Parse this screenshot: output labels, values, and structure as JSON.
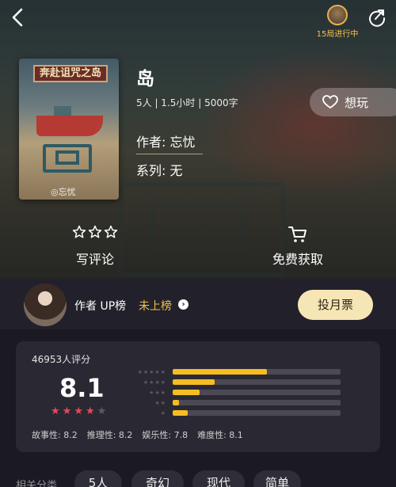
{
  "header": {
    "progress_text": "15局进行中"
  },
  "book": {
    "cover_title": "奔赴诅咒之岛",
    "cover_author": "◎忘忧",
    "title": "岛",
    "meta": "5人 | 1.5小时 | 5000字",
    "author_label": "作者: 忘忧",
    "series_label": "系列: 无",
    "want_label": "想玩"
  },
  "actions": {
    "review_label": "写评论",
    "free_label": "免费获取"
  },
  "author_bar": {
    "up_label": "作者 UP榜",
    "rank_label": "未上榜",
    "vote_label": "投月票"
  },
  "rating": {
    "count_label": "46953人评分",
    "score": "8.1",
    "stars_filled": 4,
    "stars_total": 5,
    "distribution": [
      {
        "stars": "★★★★★",
        "fraction": 0.56
      },
      {
        "stars": "★★★★",
        "fraction": 0.25
      },
      {
        "stars": "★★★",
        "fraction": 0.16
      },
      {
        "stars": "★★",
        "fraction": 0.04
      },
      {
        "stars": "★",
        "fraction": 0.09
      }
    ],
    "sub_scores": [
      {
        "label": "故事性: 8.2"
      },
      {
        "label": "推理性: 8.2"
      },
      {
        "label": "娱乐性: 7.8"
      },
      {
        "label": "难度性: 8.1"
      }
    ],
    "colors": {
      "star_active": "#e54a5c",
      "star_inactive": "#5c5b63",
      "bar": "#f5bd23"
    }
  },
  "tags": {
    "label": "相关分类",
    "items": [
      "5人",
      "奇幻",
      "现代",
      "简单"
    ]
  }
}
